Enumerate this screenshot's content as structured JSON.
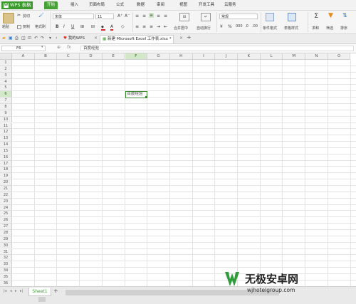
{
  "app": {
    "name": "WPS 表格"
  },
  "menu": {
    "tabs": [
      "开始",
      "插入",
      "页面布局",
      "公式",
      "数据",
      "审阅",
      "视图",
      "开发工具",
      "云服务"
    ],
    "active_index": 0
  },
  "ribbon": {
    "paste": "粘贴",
    "cut": "剪切",
    "copy": "复制",
    "format_painter": "格式刷",
    "font_name": "宋体",
    "font_size": "11",
    "merge_center": "合并居中",
    "wrap_text": "自动换行",
    "number_format": "常规",
    "conditional_format": "条件格式",
    "table_style": "表格样式",
    "sum": "求和",
    "filter": "筛选",
    "sort": "排序"
  },
  "doc_tabs": [
    {
      "label": "我的WPS",
      "active": false
    },
    {
      "label": "新建 Microsoft Excel 工作表.xlsx *",
      "active": true
    }
  ],
  "formula_bar": {
    "cell_ref": "F6",
    "fx": "fx",
    "content": "百度经验"
  },
  "sheet": {
    "columns": [
      "A",
      "B",
      "C",
      "D",
      "E",
      "F",
      "G",
      "H",
      "I",
      "J",
      "K",
      "L",
      "M",
      "N",
      "O"
    ],
    "rows": [
      "1",
      "2",
      "3",
      "4",
      "5",
      "6",
      "7",
      "8",
      "9",
      "10",
      "11",
      "12",
      "13",
      "14",
      "15",
      "16",
      "17",
      "18",
      "19",
      "20",
      "21",
      "22",
      "23",
      "24",
      "25",
      "26",
      "27",
      "28",
      "29",
      "30",
      "31",
      "32",
      "33",
      "34",
      "35",
      "36"
    ],
    "selected_column": "F",
    "selected_row": "6",
    "active_cell_value": "百度经验"
  },
  "sheet_tabs": [
    {
      "label": "Sheet1"
    }
  ],
  "add_sheet": "+",
  "watermark": {
    "title": "无极安卓网",
    "url": "wjhotelgroup.com"
  },
  "colors": {
    "brand_green": "#46a136",
    "selection_green": "#3b8a2e"
  }
}
